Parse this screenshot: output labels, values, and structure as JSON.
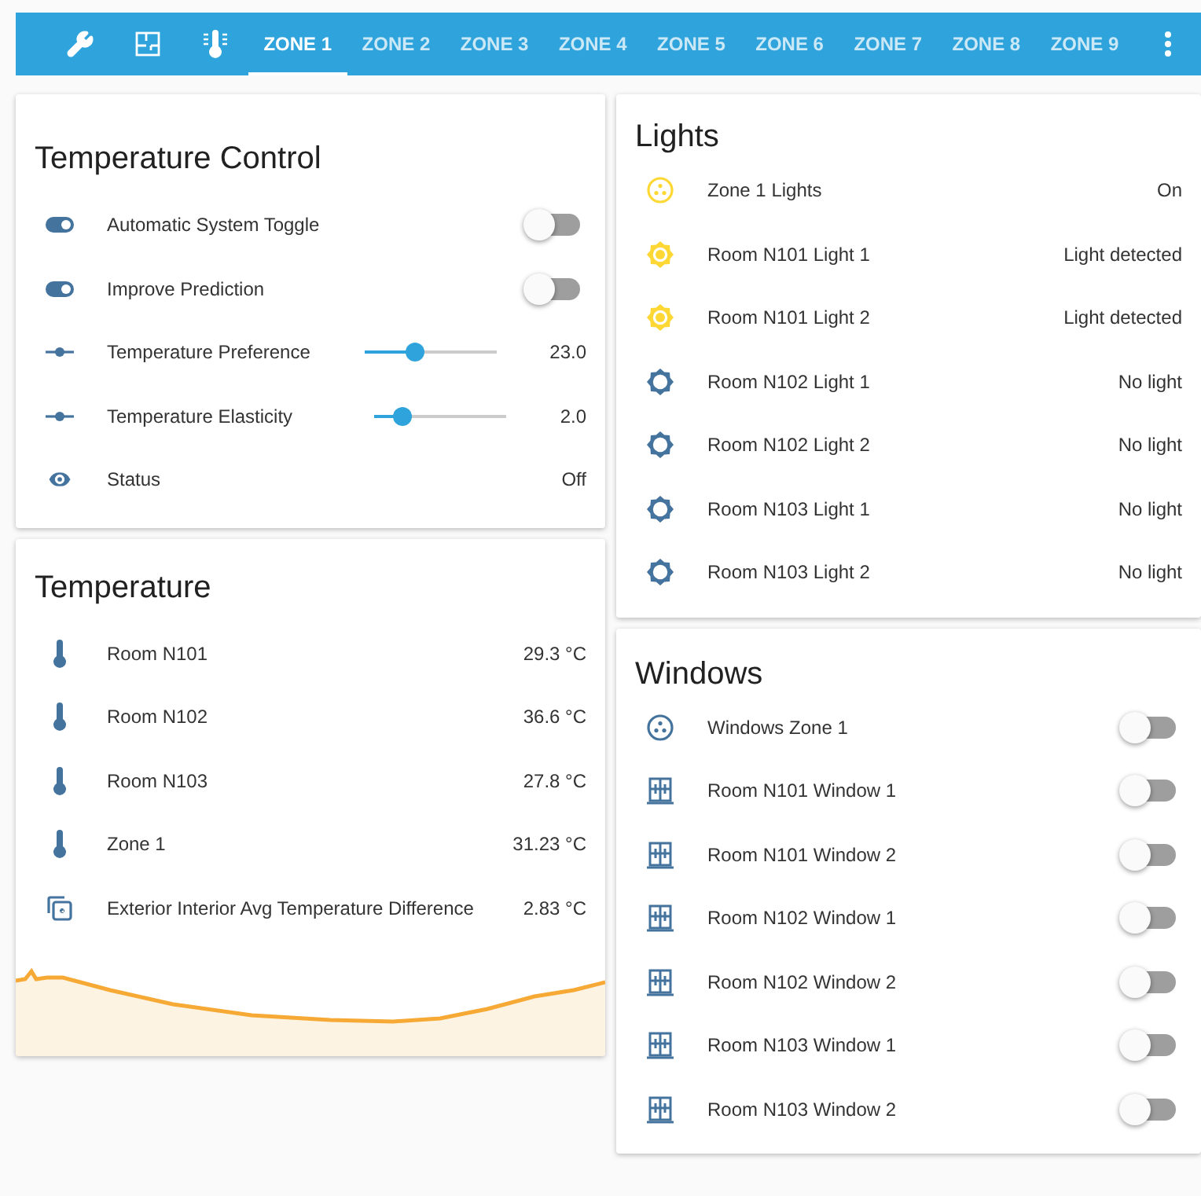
{
  "toolbar": {
    "tabs": [
      {
        "label": "ZONE 1",
        "selected": true
      },
      {
        "label": "ZONE 2",
        "selected": false
      },
      {
        "label": "ZONE 3",
        "selected": false
      },
      {
        "label": "ZONE 4",
        "selected": false
      },
      {
        "label": "ZONE 5",
        "selected": false
      },
      {
        "label": "ZONE 6",
        "selected": false
      },
      {
        "label": "ZONE 7",
        "selected": false
      },
      {
        "label": "ZONE 8",
        "selected": false
      },
      {
        "label": "ZONE 9",
        "selected": false
      }
    ]
  },
  "temperature_control": {
    "title": "Temperature Control",
    "rows": [
      {
        "kind": "toggle",
        "name": "Automatic System Toggle",
        "on": false
      },
      {
        "kind": "toggle",
        "name": "Improve Prediction",
        "on": false
      },
      {
        "kind": "slider",
        "name": "Temperature Preference",
        "level": 0.38,
        "reading": "23.0"
      },
      {
        "kind": "slider",
        "name": "Temperature Elasticity",
        "level": 0.21,
        "reading": "2.0"
      },
      {
        "kind": "status",
        "name": "Status",
        "value": "Off"
      }
    ]
  },
  "temperature": {
    "title": "Temperature",
    "rows": [
      {
        "kind": "thermometer",
        "name": "Room N101",
        "value": "29.3 °C"
      },
      {
        "kind": "thermometer",
        "name": "Room N102",
        "value": "36.6 °C"
      },
      {
        "kind": "thermometer",
        "name": "Room N103",
        "value": "27.8 °C"
      },
      {
        "kind": "thermometer",
        "name": "Zone 1",
        "value": "31.23 °C"
      },
      {
        "kind": "difference",
        "name": "Exterior Interior Avg Temperature Difference",
        "value": "2.83 °C"
      }
    ]
  },
  "lights": {
    "title": "Lights",
    "rows": [
      {
        "kind": "group",
        "name": "Zone 1 Lights",
        "on": true,
        "state": "On"
      },
      {
        "kind": "sensor",
        "name": "Room N101 Light 1",
        "on": true,
        "state": "Light detected"
      },
      {
        "kind": "sensor",
        "name": "Room N101 Light 2",
        "on": true,
        "state": "Light detected"
      },
      {
        "kind": "sensor",
        "name": "Room N102 Light 1",
        "on": false,
        "state": "No light"
      },
      {
        "kind": "sensor",
        "name": "Room N102 Light 2",
        "on": false,
        "state": "No light"
      },
      {
        "kind": "sensor",
        "name": "Room N103 Light 1",
        "on": false,
        "state": "No light"
      },
      {
        "kind": "sensor",
        "name": "Room N103 Light 2",
        "on": false,
        "state": "No light"
      }
    ]
  },
  "windows": {
    "title": "Windows",
    "rows": [
      {
        "kind": "group",
        "name": "Windows Zone 1",
        "on": false
      },
      {
        "kind": "window",
        "name": "Room N101 Window 1",
        "on": false
      },
      {
        "kind": "window",
        "name": "Room N101 Window 2",
        "on": false
      },
      {
        "kind": "window",
        "name": "Room N102 Window 1",
        "on": false
      },
      {
        "kind": "window",
        "name": "Room N102 Window 2",
        "on": false
      },
      {
        "kind": "window",
        "name": "Room N103 Window 1",
        "on": false
      },
      {
        "kind": "window",
        "name": "Room N103 Window 2",
        "on": false
      }
    ]
  }
}
